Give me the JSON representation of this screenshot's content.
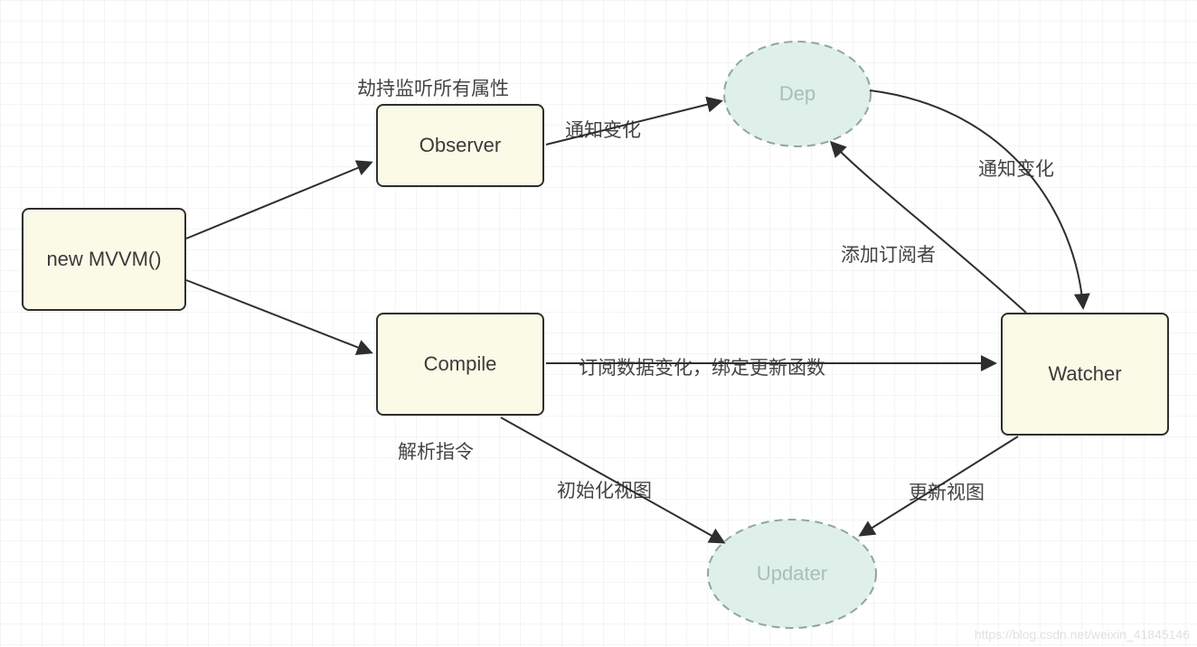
{
  "nodes": {
    "mvvm": {
      "label": "new MVVM()"
    },
    "observer": {
      "label": "Observer"
    },
    "compile": {
      "label": "Compile"
    },
    "dep": {
      "label": "Dep"
    },
    "updater": {
      "label": "Updater"
    },
    "watcher": {
      "label": "Watcher"
    }
  },
  "labels": {
    "intercept": "劫持监听所有属性",
    "notify1": "通知变化",
    "notify2": "通知变化",
    "addSub": "添加订阅者",
    "subscribe": "订阅数据变化，绑定更新函数",
    "parse": "解析指令",
    "initView": "初始化视图",
    "updateView": "更新视图"
  },
  "watermark": "https://blog.csdn.net/weixin_41845146",
  "colors": {
    "rectFill": "#fbfae7",
    "ellipseFill": "#def0e9",
    "stroke": "#2e2e2e",
    "text": "#444"
  }
}
